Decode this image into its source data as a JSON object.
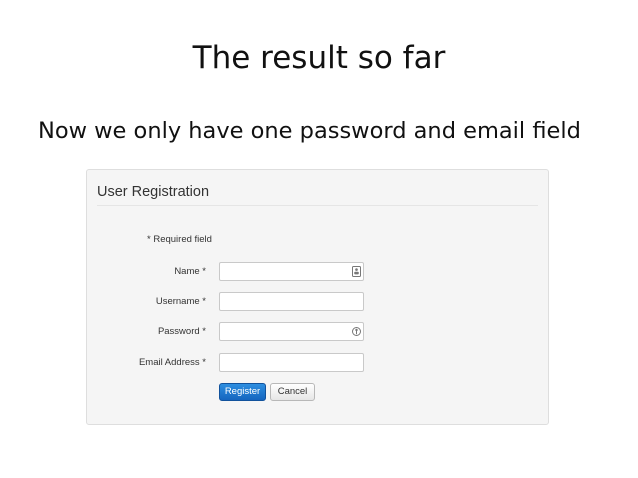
{
  "slide": {
    "title": "The result so far",
    "bullet": "Now we only have one password and email field"
  },
  "form": {
    "heading": "User Registration",
    "required_note": "* Required field",
    "fields": [
      {
        "label": "Name *",
        "value": "",
        "icon": "id-card-icon"
      },
      {
        "label": "Username *",
        "value": ""
      },
      {
        "label": "Password *",
        "value": "",
        "icon": "key-icon"
      },
      {
        "label": "Email Address *",
        "value": ""
      }
    ],
    "buttons": {
      "register": "Register",
      "cancel": "Cancel"
    },
    "colors": {
      "panel_background": "#f5f5f5",
      "primary_button": "#1a72cf"
    }
  }
}
